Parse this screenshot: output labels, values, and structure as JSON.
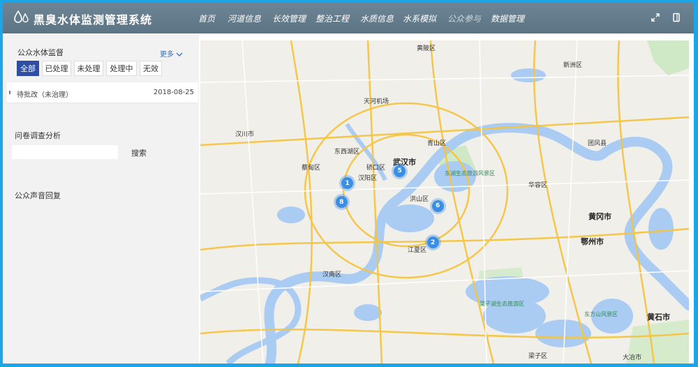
{
  "header": {
    "title": "黑臭水体监测管理系统",
    "nav": [
      {
        "label": "首页",
        "dim": false
      },
      {
        "label": "河道信息",
        "dim": false
      },
      {
        "label": "长效管理",
        "dim": false
      },
      {
        "label": "整治工程",
        "dim": false
      },
      {
        "label": "水质信息",
        "dim": false
      },
      {
        "label": "水系模拟",
        "dim": false
      },
      {
        "label": "公众参与",
        "dim": true
      },
      {
        "label": "数据管理",
        "dim": false
      }
    ]
  },
  "sidebar": {
    "supervision_title": "公众水体监督",
    "more_label": "更多",
    "filters": [
      {
        "label": "全部",
        "active": true
      },
      {
        "label": "已处理",
        "active": false
      },
      {
        "label": "未处理",
        "active": false
      },
      {
        "label": "处理中",
        "active": false
      },
      {
        "label": "无效",
        "active": false
      }
    ],
    "report": {
      "status": "待批改（未治理）",
      "date": "2018-08-25"
    },
    "survey_title": "问卷调查分析",
    "search_placeholder": "",
    "search_label": "搜索",
    "voice_title": "公众声音回复"
  },
  "map": {
    "labels": {
      "wuhan": "武汉市",
      "huangpi": "黄陂区",
      "xinzhou": "新洲区",
      "dongxihu": "东西湖区",
      "caidian": "蔡甸区",
      "hanyang": "汉阳区",
      "qiaokou": "硚口区",
      "hongshan": "洪山区",
      "qingshan": "青山区",
      "jiangxia": "江夏区",
      "hannan": "汉南区",
      "huarong": "华容区",
      "ezhou": "鄂州市",
      "huanggang": "黄冈市",
      "tuanfeng": "团风县",
      "huangshi": "黄石市",
      "daye": "大冶市",
      "liangzi": "梁子区",
      "hanchuan": "汉川市",
      "tianhe": "天河机场",
      "donghu": "东湖生态旅游风景区",
      "liangzihu": "梁子湖生态旅游区",
      "dongfangshan": "东方山风景区"
    },
    "clusters": [
      {
        "count": "5",
        "fx": 0.408,
        "fy": 0.404
      },
      {
        "count": "1",
        "fx": 0.301,
        "fy": 0.442
      },
      {
        "count": "8",
        "fx": 0.289,
        "fy": 0.501
      },
      {
        "count": "6",
        "fx": 0.486,
        "fy": 0.512
      },
      {
        "count": "2",
        "fx": 0.476,
        "fy": 0.626
      }
    ]
  }
}
